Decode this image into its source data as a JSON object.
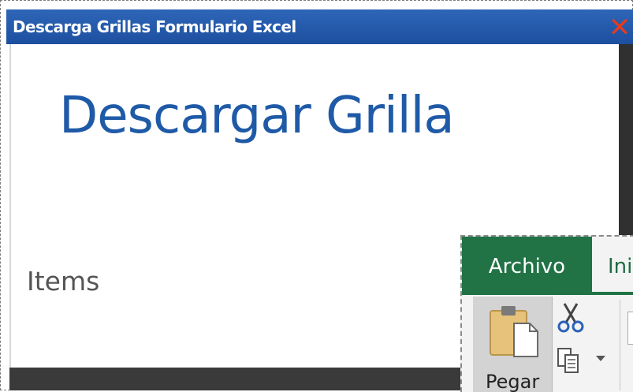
{
  "window": {
    "title": "Descarga Grillas Formulario Excel",
    "close_glyph": "✕"
  },
  "main": {
    "heading": "Descargar Grilla",
    "items_label": "Items"
  },
  "excel_ribbon": {
    "tabs": [
      {
        "label": "Archivo",
        "active": true
      },
      {
        "label": "Ini",
        "active": false
      }
    ],
    "paste_label": "Pegar",
    "icons": [
      "clipboard-icon",
      "scissors-icon",
      "copy-icon"
    ]
  },
  "colors": {
    "titlebar": "#1d4f9f",
    "heading": "#1f5aa7",
    "excel_green": "#217346",
    "close": "#e53b1c"
  }
}
